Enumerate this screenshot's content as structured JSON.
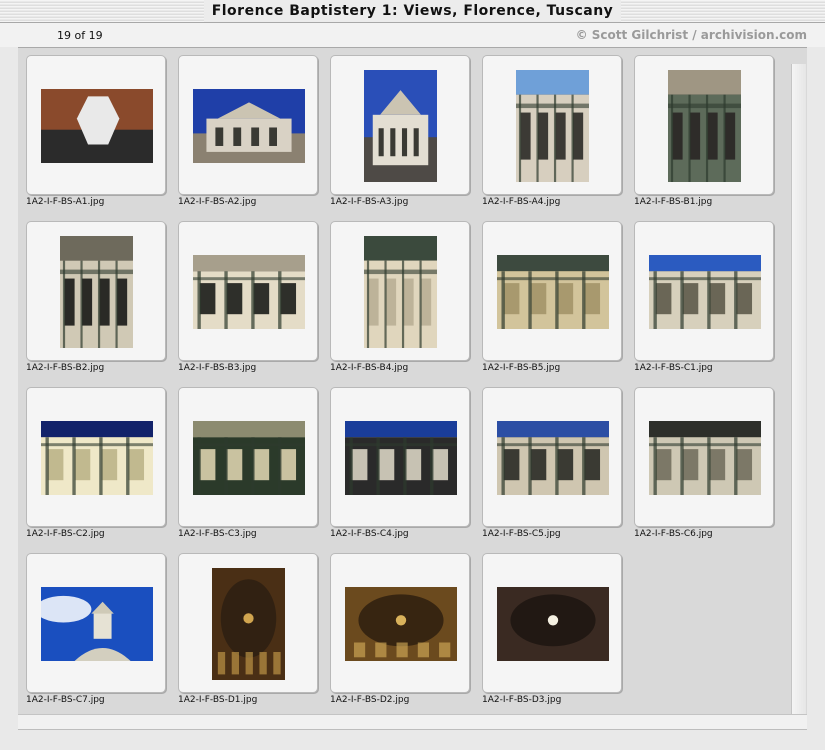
{
  "window": {
    "title": "Florence Baptistery 1: Views, Florence, Tuscany"
  },
  "header": {
    "count": "19 of 19",
    "credit": "© Scott Gilchrist / archivision.com"
  },
  "thumbnails": [
    {
      "file": "1A2-I-F-BS-A1.jpg",
      "orient": "landscape",
      "scene": "aerial",
      "top": "#8a4a2c",
      "bottom": "#2b2b2b",
      "accent": "#e9e9e9"
    },
    {
      "file": "1A2-I-F-BS-A2.jpg",
      "orient": "landscape",
      "scene": "building",
      "top": "#1f3fa8",
      "bottom": "#8b8171",
      "accent": "#d9d2c5"
    },
    {
      "file": "1A2-I-F-BS-A3.jpg",
      "orient": "portrait",
      "scene": "building",
      "top": "#2a4fb8",
      "bottom": "#4e4a46",
      "accent": "#e3ded2"
    },
    {
      "file": "1A2-I-F-BS-A4.jpg",
      "orient": "portrait",
      "scene": "facade",
      "top": "#6fa0d8",
      "bottom": "#3c3a35",
      "accent": "#d7cfbf"
    },
    {
      "file": "1A2-I-F-BS-B1.jpg",
      "orient": "portrait",
      "scene": "facade",
      "top": "#9f9683",
      "bottom": "#2e2c29",
      "accent": "#5d6b5a"
    },
    {
      "file": "1A2-I-F-BS-B2.jpg",
      "orient": "portrait",
      "scene": "facade",
      "top": "#6e6a5c",
      "bottom": "#2a2a26",
      "accent": "#d0c9b5"
    },
    {
      "file": "1A2-I-F-BS-B3.jpg",
      "orient": "landscape",
      "scene": "facade",
      "top": "#a79f8c",
      "bottom": "#2e2f2a",
      "accent": "#e4dcc7"
    },
    {
      "file": "1A2-I-F-BS-B4.jpg",
      "orient": "portrait",
      "scene": "window",
      "top": "#3b4a3d",
      "bottom": "#bdb399",
      "accent": "#e0d6bd"
    },
    {
      "file": "1A2-I-F-BS-B5.jpg",
      "orient": "landscape",
      "scene": "wall",
      "top": "#3d4a3f",
      "bottom": "#a8996e",
      "accent": "#d2c49b"
    },
    {
      "file": "1A2-I-F-BS-C1.jpg",
      "orient": "landscape",
      "scene": "cornice",
      "top": "#2b5bc0",
      "bottom": "#6a6656",
      "accent": "#d7d0bc"
    },
    {
      "file": "1A2-I-F-BS-C2.jpg",
      "orient": "landscape",
      "scene": "cornice",
      "top": "#12226a",
      "bottom": "#c1b98f",
      "accent": "#efe8c8"
    },
    {
      "file": "1A2-I-F-BS-C3.jpg",
      "orient": "landscape",
      "scene": "wall",
      "top": "#8c8b70",
      "bottom": "#c9c2a0",
      "accent": "#2b3a2a"
    },
    {
      "file": "1A2-I-F-BS-C4.jpg",
      "orient": "landscape",
      "scene": "cornice",
      "top": "#1a3d9a",
      "bottom": "#c7c2b3",
      "accent": "#2a2a2a"
    },
    {
      "file": "1A2-I-F-BS-C5.jpg",
      "orient": "landscape",
      "scene": "facade",
      "top": "#2c4ea4",
      "bottom": "#3a3a33",
      "accent": "#cfc6b0"
    },
    {
      "file": "1A2-I-F-BS-C6.jpg",
      "orient": "landscape",
      "scene": "facade",
      "top": "#2d2f2a",
      "bottom": "#7c7867",
      "accent": "#cec8b4"
    },
    {
      "file": "1A2-I-F-BS-C7.jpg",
      "orient": "landscape",
      "scene": "sky",
      "top": "#1a4fbf",
      "bottom": "#d3cfbf",
      "accent": "#ffffff"
    },
    {
      "file": "1A2-I-F-BS-D1.jpg",
      "orient": "portrait",
      "scene": "interior",
      "top": "#4a2f15",
      "bottom": "#2a1e12",
      "accent": "#d1a54f"
    },
    {
      "file": "1A2-I-F-BS-D2.jpg",
      "orient": "landscape",
      "scene": "mosaic",
      "top": "#6b4a1e",
      "bottom": "#2a1c0e",
      "accent": "#d9b25b"
    },
    {
      "file": "1A2-I-F-BS-D3.jpg",
      "orient": "landscape",
      "scene": "dome",
      "top": "#3a2a22",
      "bottom": "#1c1410",
      "accent": "#f4efe1"
    }
  ]
}
